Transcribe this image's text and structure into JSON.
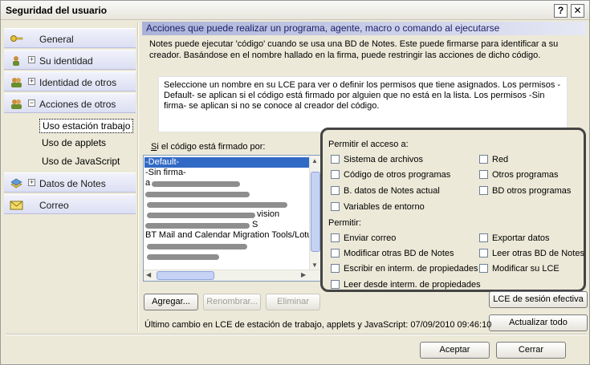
{
  "window": {
    "title": "Seguridad del usuario",
    "help_label": "?",
    "close_label": "✕"
  },
  "nav": {
    "items": [
      {
        "label": "General",
        "icon": "key-icon"
      },
      {
        "label": "Su identidad",
        "icon": "person-icon",
        "expander": "+"
      },
      {
        "label": "Identidad de otros",
        "icon": "people-icon",
        "expander": "+"
      },
      {
        "label": "Acciones de otros",
        "icon": "people-gear-icon",
        "expander": "−"
      },
      {
        "label": "Datos de Notes",
        "icon": "database-icon",
        "expander": "+"
      },
      {
        "label": "Correo",
        "icon": "mail-icon"
      }
    ],
    "subitems": [
      "Uso estación trabajo",
      "Uso de applets",
      "Uso de JavaScript"
    ]
  },
  "main": {
    "header": "Acciones que puede realizar un programa, agente, macro o comando al ejecutarse",
    "description": "Notes puede ejecutar 'código' cuando se usa una BD de Notes. Este puede firmarse para identificar a su creador. Basándose en el nombre hallado en la firma, puede restringir las acciones de dicho código.",
    "info": "Seleccione un nombre en su LCE para ver o definir los permisos que tiene asignados. Los permisos -Default- se aplican si el código está firmado por alguien que no está en la lista. Los permisos -Sin firma- se aplican si no se conoce al creador del código.",
    "signed_label_first": "S",
    "signed_label_rest": "i el código está firmado por:",
    "list": [
      "-Default-",
      "-Sin firma-",
      "a",
      "",
      "",
      "vision",
      "S",
      "BT Mail and Calendar Migration Tools/Lotu",
      "",
      "",
      ""
    ],
    "access": {
      "title": "Permitir el acceso a:",
      "items": [
        "Sistema de archivos",
        "Red",
        "Código de otros programas",
        "Otros programas",
        "B. datos de Notes actual",
        "BD otros programas",
        "Variables de entorno"
      ]
    },
    "allow": {
      "title": "Permitir:",
      "items": [
        "Enviar correo",
        "Exportar datos",
        "Modificar otras BD de Notes",
        "Leer otras BD de Notes",
        "Escribir en interm. de propiedades",
        "Modificar su LCE",
        "Leer desde interm. de propiedades"
      ]
    },
    "buttons": {
      "add": "Agregar...",
      "rename": "Renombrar...",
      "delete": "Eliminar",
      "session": "LCE de sesión efectiva",
      "refresh": "Actualizar todo"
    },
    "last_change": "Último cambio en LCE de estación de trabajo, applets y JavaScript:  07/09/2010 09:46:10"
  },
  "footer": {
    "ok": "Aceptar",
    "cancel": "Cerrar"
  },
  "colors": {
    "selection": "#316ac5",
    "header": "#aab2d8",
    "header_text": "#1b1f6a"
  }
}
